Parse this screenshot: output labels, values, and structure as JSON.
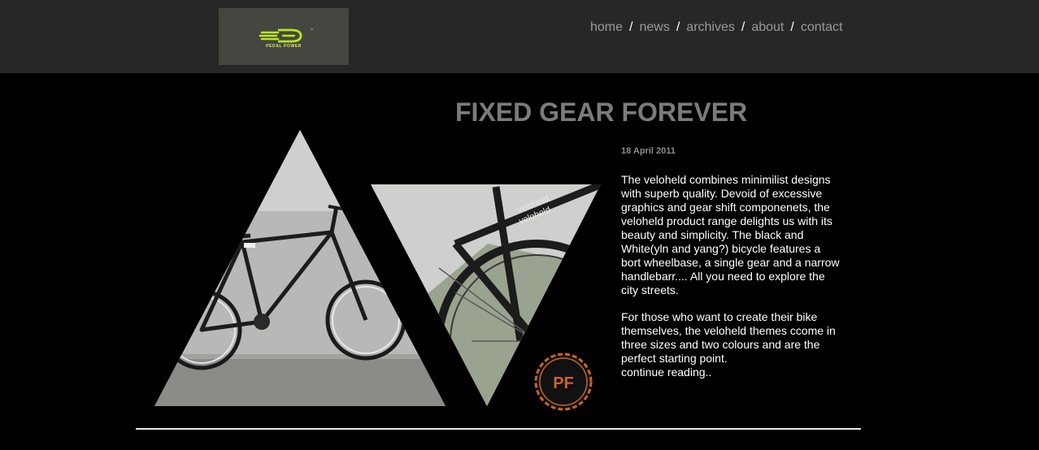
{
  "header": {
    "logo": {
      "text": "PEDAL POWER",
      "mark": "PP",
      "brand_color": "#b9e61e"
    },
    "nav": [
      {
        "label": "home"
      },
      {
        "label": "news"
      },
      {
        "label": "archives"
      },
      {
        "label": "about"
      },
      {
        "label": "contact"
      }
    ],
    "separator": "/"
  },
  "article": {
    "title": "FIXED GEAR FOREVER",
    "date": "18 April 2011",
    "paragraph1": "The veloheld combines minimilist designs with superb quality. Devoid of excessive graphics and gear shift componenets, the veloheld product range delights us with its beauty and simplicity. The black and White(yln and yang?) bicycle features a bort wheelbase, a single gear and a narrow handlebarr.... All you need to explore the city streets.",
    "paragraph2": "For those who want to create their bike themselves, the veloheld themes ccome in three sizes and two colours and are the perfect starting point.",
    "read_more": "continue reading..",
    "image": {
      "frame_text": "veloheld",
      "badge_text": "PF",
      "badge_color": "#c8642a"
    }
  },
  "colors": {
    "header_bg": "#272727",
    "page_bg": "#000000",
    "title": "#7b7b7b",
    "nav_link": "#9a9a9a",
    "body_text": "#ffffff"
  }
}
